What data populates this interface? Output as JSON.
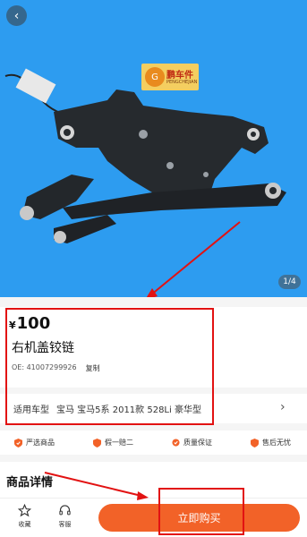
{
  "hero": {
    "page_indicator": "1/4",
    "logo_brand": "鹏车件",
    "logo_subtext": "PENGCHEJIAN",
    "back_icon": "chevron-left-icon",
    "background_color": "#2d9cf0"
  },
  "product": {
    "currency": "¥",
    "price": "100",
    "title": "右机盖铰链",
    "oe_label": "OE: 41007299926",
    "copy_label": "复制"
  },
  "fitment": {
    "label": "适用车型",
    "value": "宝马 宝马5系 2011款 528Li 豪华型",
    "chevron_icon": "chevron-right-icon"
  },
  "guarantees": [
    {
      "label": "严选商品",
      "icon": "check-shield-icon"
    },
    {
      "label": "假一赔二",
      "icon": "shield-icon"
    },
    {
      "label": "质量保证",
      "icon": "badge-icon"
    },
    {
      "label": "售后无忧",
      "icon": "shield-icon"
    }
  ],
  "details": {
    "heading": "商品详情"
  },
  "bottom_bar": {
    "favorite_label": "收藏",
    "service_label": "客服",
    "buy_label": "立即购买",
    "accent_color": "#f26228"
  },
  "annotation_color": "#e21212"
}
